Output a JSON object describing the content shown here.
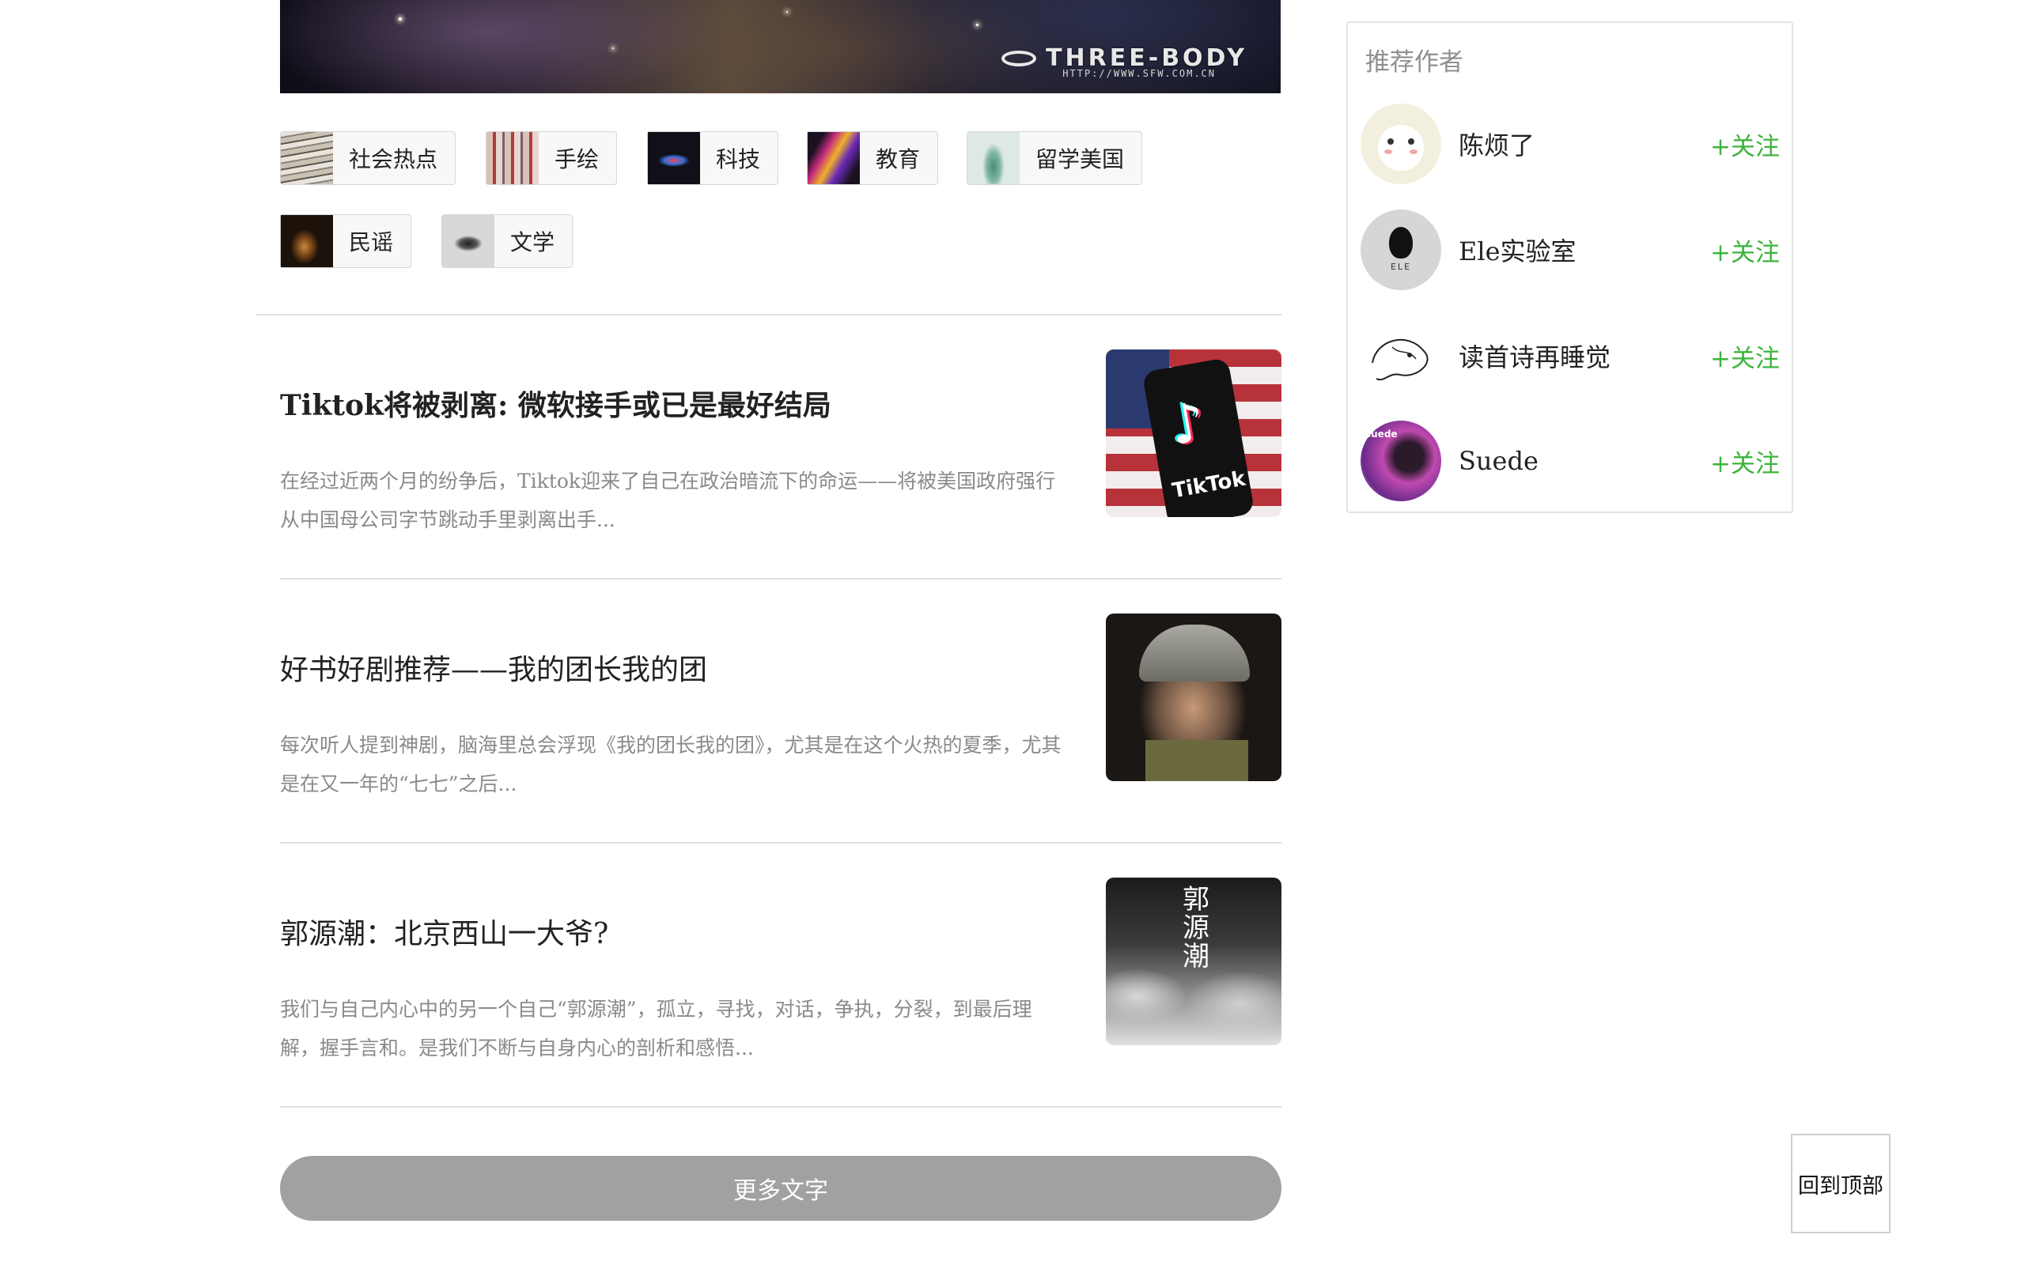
{
  "banner": {
    "logo_text": "THREE-BODY",
    "url_text": "HTTP://WWW.SFW.COM.CN"
  },
  "tags": [
    {
      "label": "社会热点",
      "icon": "newspaper-stack-thumb"
    },
    {
      "label": "手绘",
      "icon": "hand-drawing-thumb"
    },
    {
      "label": "科技",
      "icon": "tech-lips-thumb"
    },
    {
      "label": "教育",
      "icon": "graffiti-thumb"
    },
    {
      "label": "留学美国",
      "icon": "statue-of-liberty-thumb"
    },
    {
      "label": "民谣",
      "icon": "guitar-thumb"
    },
    {
      "label": "文学",
      "icon": "typewriter-thumb"
    }
  ],
  "articles": [
    {
      "title": "Tiktok将被剥离: 微软接手或已是最好结局",
      "excerpt": "在经过近两个月的纷争后，Tiktok迎来了自己在政治暗流下的命运——将被美国政府强行从中国母公司字节跳动手里剥离出手...",
      "image": "tiktok-logo-flag",
      "image_text": "TikTok"
    },
    {
      "title": "好书好剧推荐——我的团长我的团",
      "excerpt": "每次听人提到神剧，脑海里总会浮现《我的团长我的团》，尤其是在这个火热的夏季，尤其是在又一年的“七七”之后...",
      "image": "soldier-portrait"
    },
    {
      "title": "郭源潮：北京西山一大爷?",
      "excerpt": "我们与自己内心中的另一个自己“郭源潮”，孤立，寻找，对话，争执，分裂，到最后理解，握手言和。是我们不断与自身内心的剖析和感悟...",
      "image": "ink-landscape",
      "image_text": "郭源潮"
    }
  ],
  "more_button": "更多文字",
  "sidebar": {
    "title": "推荐作者",
    "authors": [
      {
        "name": "陈烦了",
        "follow": "+关注",
        "avatar": "cartoon-cat-avatar"
      },
      {
        "name": "Ele实验室",
        "follow": "+关注",
        "avatar": "ele-lab-avatar",
        "avatar_text": "ELE"
      },
      {
        "name": "读首诗再睡觉",
        "follow": "+关注",
        "avatar": "sketch-avatar"
      },
      {
        "name": "Suede",
        "follow": "+关注",
        "avatar": "suede-band-avatar",
        "avatar_text": "suede"
      }
    ]
  },
  "back_to_top": "回到顶部",
  "colors": {
    "follow": "#3cb43c",
    "more_button_bg": "#a1a1a1",
    "excerpt": "#8a8a8a"
  }
}
